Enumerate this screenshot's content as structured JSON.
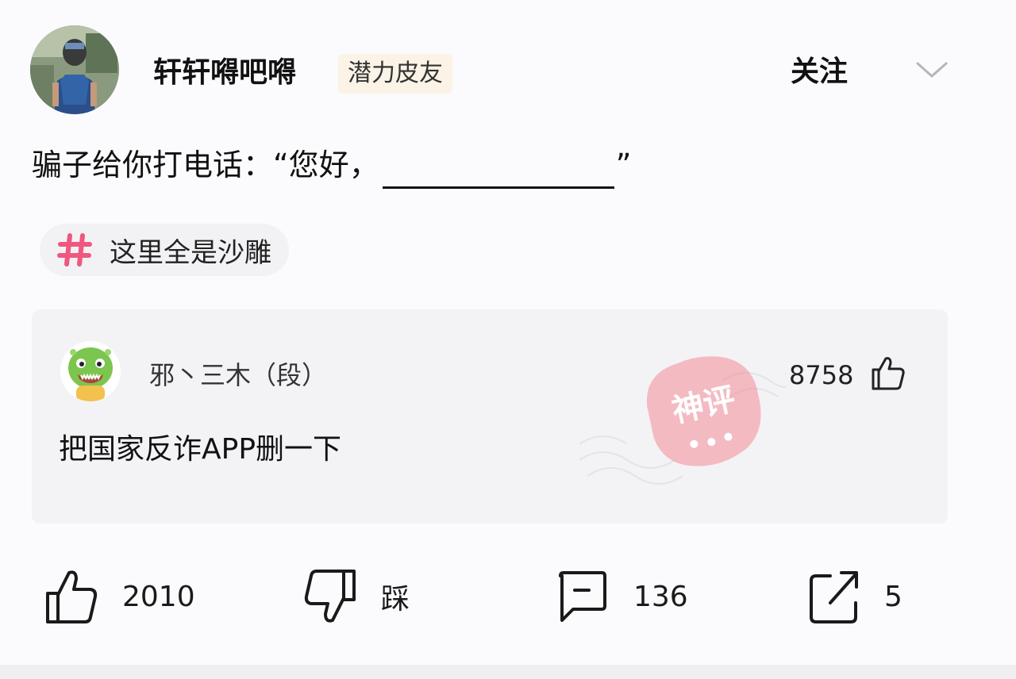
{
  "post": {
    "author": {
      "name": "轩轩嘚吧嘚",
      "badge": "潜力皮友",
      "avatar_icon": "user-avatar-photo"
    },
    "follow_label": "关注",
    "text_prefix": "骗子给你打电话：“您好，",
    "text_suffix": "”",
    "topic": {
      "icon": "hash-icon",
      "label": "这里全是沙雕",
      "icon_color": "#f0577f"
    }
  },
  "hot_comment": {
    "author": "邪丶三木（段）",
    "likes": "8758",
    "text": "把国家反诈APP删一下",
    "stamp": {
      "text": "神评",
      "color": "#f06a7e"
    }
  },
  "actions": {
    "like_count": "2010",
    "dislike_label": "踩",
    "comment_count": "136",
    "share_count": "5"
  }
}
